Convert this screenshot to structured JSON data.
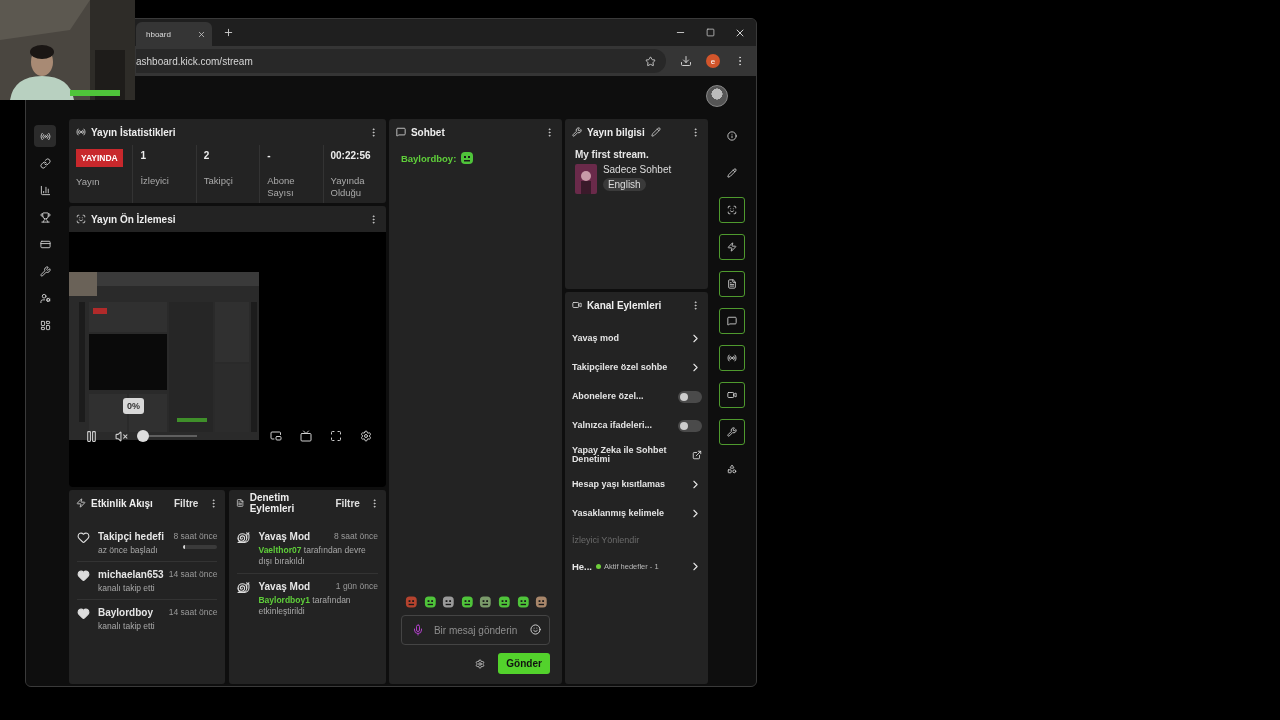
{
  "browser": {
    "tab_title": "hboard",
    "url": "ashboard.kick.com/stream",
    "profile_initial": "e"
  },
  "left_rail": [
    {
      "selected": true
    },
    {
      "selected": false
    },
    {
      "selected": false
    },
    {
      "selected": false
    },
    {
      "selected": false
    },
    {
      "selected": false
    },
    {
      "selected": false
    },
    {
      "selected": false
    }
  ],
  "stats": {
    "title": "Yayın İstatistikleri",
    "items": [
      {
        "kind": "badge",
        "value": "YAYINDA",
        "label": "Yayın"
      },
      {
        "kind": "number",
        "value": "1",
        "label": "İzleyici"
      },
      {
        "kind": "number",
        "value": "2",
        "label": "Takipçi"
      },
      {
        "kind": "number",
        "value": "-",
        "label": "Abone Sayısı"
      },
      {
        "kind": "number",
        "value": "00:22:56",
        "label": "Yayında Olduğu"
      }
    ]
  },
  "preview": {
    "title": "Yayın Ön İzlemesi",
    "volume_tooltip": "0%",
    "volume": {
      "level": 0
    }
  },
  "events": {
    "title": "Etkinlik Akışı",
    "filter": "Filtre",
    "items": [
      {
        "kind": "goal",
        "name": "Takipçi hedefi",
        "time": "8 saat önce",
        "detail": "az önce başladı",
        "level": 0.04
      },
      {
        "kind": "follow",
        "name": "michaelan653",
        "time": "14 saat önce",
        "detail": "kanalı takip etti"
      },
      {
        "kind": "follow",
        "name": "Baylordboy",
        "time": "14 saat önce",
        "detail": "kanalı takip etti"
      }
    ]
  },
  "moderation": {
    "title": "Denetim Eylemleri",
    "filter": "Filtre",
    "items": [
      {
        "action": "Yavaş Mod",
        "time": "8 saat önce",
        "user": "Vaelthor07",
        "detail": "tarafından devre dışı bırakıldı"
      },
      {
        "action": "Yavaş Mod",
        "time": "1 gün önce",
        "user": "Baylordboy1",
        "detail": "tarafından etkinleştirildi"
      }
    ]
  },
  "chat": {
    "title": "Sohbet",
    "messages": [
      {
        "user": "Baylordboy:"
      }
    ],
    "placeholder": "Bir mesaj gönderin",
    "send": "Gönder"
  },
  "stream_info": {
    "title": "Yayın bilgisi",
    "stream_title": "My first stream.",
    "category": "Sadece Sohbet",
    "language": "English"
  },
  "channel_actions": {
    "title": "Kanal Eylemleri",
    "items": [
      {
        "kind": "link",
        "label": "Yavaş mod"
      },
      {
        "kind": "link",
        "label": "Takipçilere özel sohbe"
      },
      {
        "kind": "toggle",
        "label": "Abonelere özel...",
        "on": false
      },
      {
        "kind": "toggle",
        "label": "Yalnızca ifadeleri...",
        "on": false
      },
      {
        "kind": "external",
        "label": "Yapay Zeka ile Sohbet Denetimi"
      },
      {
        "kind": "link",
        "label": "Hesap yaşı kısıtlamas"
      },
      {
        "kind": "link",
        "label": "Yasaklanmış kelimele"
      },
      {
        "kind": "heading",
        "label": "İzleyici Yönlendir"
      },
      {
        "kind": "goal",
        "label": "He...",
        "status": "Aktif hedefler - 1",
        "color": "#6fcf3b"
      }
    ]
  },
  "right_rail": [
    {
      "on": false
    },
    {
      "on": false
    },
    {
      "on": true
    },
    {
      "on": true
    },
    {
      "on": true
    },
    {
      "on": true
    },
    {
      "on": true
    },
    {
      "on": true
    },
    {
      "on": true
    },
    {
      "on": false
    }
  ]
}
